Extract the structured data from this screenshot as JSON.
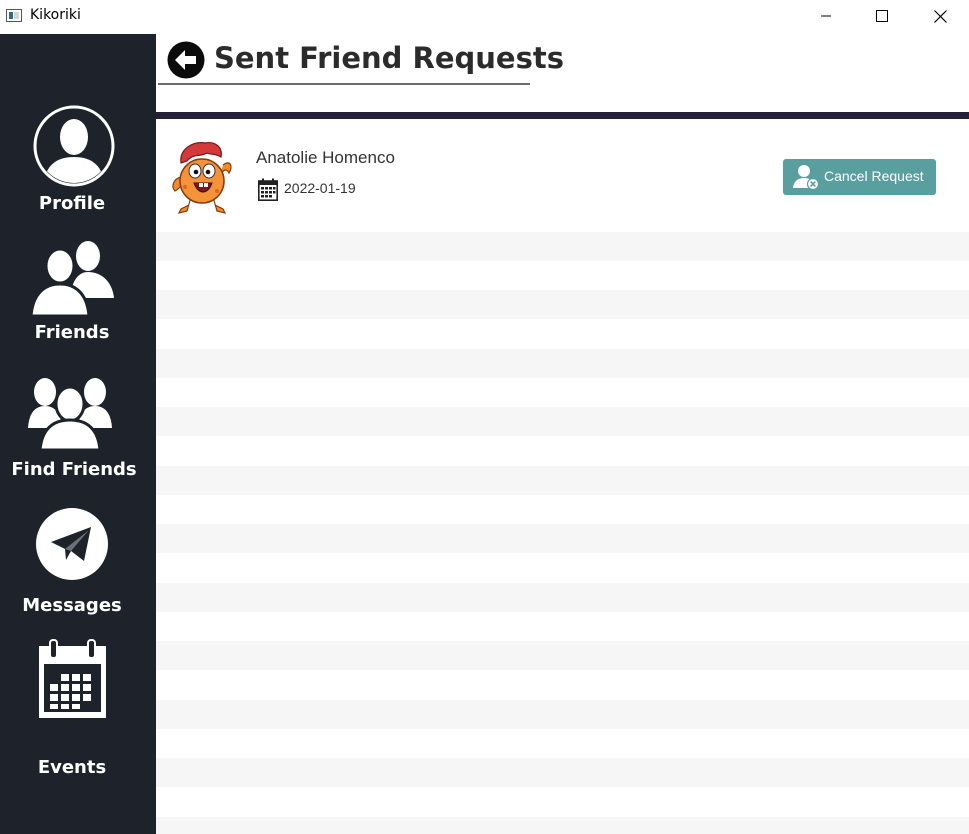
{
  "window": {
    "title": "Kikoriki"
  },
  "sidebar": {
    "items": [
      {
        "label": "Profile",
        "icon": "profile-icon"
      },
      {
        "label": "Friends",
        "icon": "friends-icon"
      },
      {
        "label": "Find Friends",
        "icon": "find-friends-icon"
      },
      {
        "label": "Messages",
        "icon": "paper-plane-icon"
      },
      {
        "label": "Events",
        "icon": "calendar-icon"
      }
    ]
  },
  "header": {
    "title": "Sent Friend Requests"
  },
  "requests": [
    {
      "name": "Anatolie Homenco",
      "date": "2022-01-19",
      "button_label": "Cancel Request"
    }
  ],
  "colors": {
    "sidebar_bg": "#1e232b",
    "divider": "#242037",
    "button": "#5a9fa0",
    "row_stripe": "#f6f6f6"
  }
}
